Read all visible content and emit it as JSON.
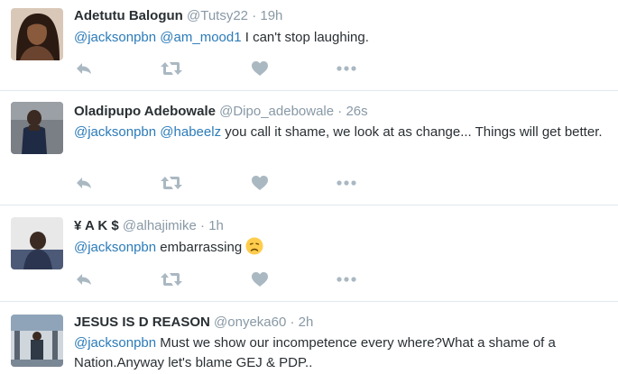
{
  "colors": {
    "mention": "#2b7bb9",
    "meta": "#8899a6",
    "icon": "#aab8c2",
    "divider": "#e1e8ed",
    "text": "#292f33"
  },
  "tweets": [
    {
      "name": "Adetutu Balogun",
      "handle": "@Tutsy22",
      "separator": "·",
      "time": "19h",
      "mentions": [
        "@jacksonpbn",
        "@am_mood1"
      ],
      "body": "I can't stop laughing."
    },
    {
      "name": "Oladipupo Adebowale",
      "handle": "@Dipo_adebowale",
      "separator": "·",
      "time": "26s",
      "mentions": [
        "@jacksonpbn",
        "@habeelz"
      ],
      "body": "you call it shame, we look at as change... Things will get better."
    },
    {
      "name": "¥ A K $",
      "handle": "@alhajimike",
      "separator": "·",
      "time": "1h",
      "mentions": [
        "@jacksonpbn"
      ],
      "body": "embarrassing",
      "emoji": "disappointed-face"
    },
    {
      "name": "JESUS IS D REASON",
      "handle": "@onyeka60",
      "separator": "·",
      "time": "2h",
      "mentions": [
        "@jacksonpbn"
      ],
      "body": "Must we show our incompetence every where?What a shame of a Nation.Anyway let's blame GEJ & PDP.."
    }
  ],
  "action_icons": [
    "reply-icon",
    "retweet-icon",
    "like-icon",
    "more-icon"
  ]
}
